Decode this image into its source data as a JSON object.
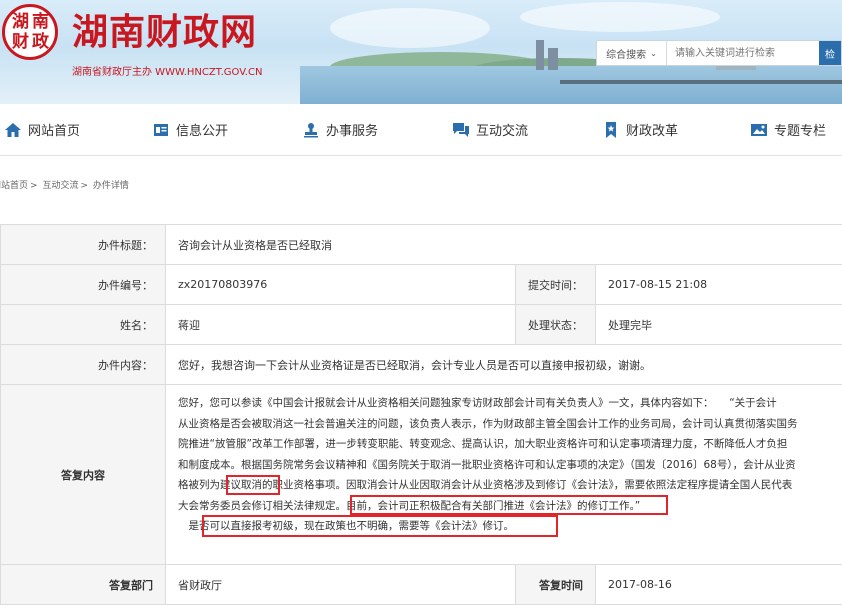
{
  "header": {
    "seal_text": [
      "湖",
      "南",
      "财",
      "政"
    ],
    "site_title": "湖南财政网",
    "site_subtitle": "湖南省财政厅主办 WWW.HNCZT.GOV.CN",
    "search": {
      "scope": "综合搜索",
      "placeholder": "请输入关键词进行检索",
      "button_label": "检"
    }
  },
  "nav": [
    {
      "label": "网站首页",
      "icon": "home-icon"
    },
    {
      "label": "信息公开",
      "icon": "document-icon"
    },
    {
      "label": "办事服务",
      "icon": "stamp-icon"
    },
    {
      "label": "互动交流",
      "icon": "chat-icon"
    },
    {
      "label": "财政改革",
      "icon": "bookmark-icon"
    },
    {
      "label": "专题专栏",
      "icon": "picture-icon"
    }
  ],
  "breadcrumb": [
    "网站首页",
    "互动交流",
    "办件详情"
  ],
  "detail": {
    "title_label": "办件标题：",
    "title_value": "咨询会计从业资格是否已经取消",
    "number_label": "办件编号：",
    "number_value": "zx20170803976",
    "submit_time_label": "提交时间：",
    "submit_time_value": "2017-08-15 21:08",
    "name_label": "姓名：",
    "name_value": "蒋迎",
    "status_label": "处理状态：",
    "status_value": "处理完毕",
    "content_label": "办件内容：",
    "content_value": "您好，我想咨询一下会计从业资格证是否已经取消，会计专业人员是否可以直接申报初级，谢谢。",
    "answer_label": "答复内容",
    "answer_lines": [
      "您好，您可以参读《中国会计报就会计从业资格相关问题独家专访财政部会计司有关负责人》一文，具体内容如下：　　“关于会计",
      "从业资格是否会被取消这一社会普遍关注的问题，该负责人表示，作为财政部主管全国会计工作的业务司局，会计司认真贯彻落实国务",
      "院推进“放管服”改革工作部署，进一步转变职能、转变观念、提高认识，加大职业资格许可和认定事项清理力度，不断降低人才负担",
      "和制度成本。根据国务院常务会议精神和《国务院关于取消一批职业资格许可和认定事项的决定》（国发〔2016〕68号），会计从业资",
      "格被列为建议取消的职业资格事项。因取消会计从业因取消会计从业资格涉及到修订《会计法》，需要依照法定程序提请全国人民代表",
      "大会常务委员会修订相关法律规定。目前，会计司正积极配合有关部门推进《会计法》的修订工作。”",
      "　是否可以直接报考初级，现在政策也不明确，需要等《会计法》修订。"
    ],
    "dept_label": "答复部门",
    "dept_value": "省财政厅",
    "reply_time_label": "答复时间",
    "reply_time_value": "2017-08-16"
  },
  "colors": {
    "brand_red": "#c8171e",
    "nav_icon_blue": "#2a6ead",
    "highlight_red": "#e0252b"
  }
}
